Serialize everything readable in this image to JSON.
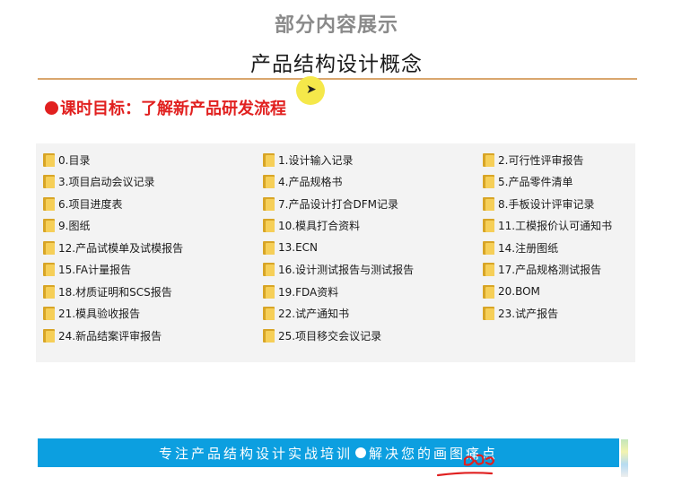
{
  "header": {
    "top_title": "部分内容展示",
    "slide_title": "产品结构设计概念"
  },
  "objective": {
    "text": "课时目标：了解新产品研发流程",
    "color": "#e1201f"
  },
  "files": [
    {
      "label": "0.目录",
      "icon": "folder-icon"
    },
    {
      "label": "1.设计输入记录",
      "icon": "folder-icon"
    },
    {
      "label": "2.可行性评审报告",
      "icon": "folder-icon"
    },
    {
      "label": "3.项目启动会议记录",
      "icon": "folder-icon"
    },
    {
      "label": "4.产品规格书",
      "icon": "folder-icon"
    },
    {
      "label": "5.产品零件清单",
      "icon": "folder-icon"
    },
    {
      "label": "6.项目进度表",
      "icon": "folder-icon"
    },
    {
      "label": "7.产品设计打合DFM记录",
      "icon": "folder-icon"
    },
    {
      "label": "8.手板设计评审记录",
      "icon": "folder-icon"
    },
    {
      "label": "9.图纸",
      "icon": "folder-icon"
    },
    {
      "label": "10.模具打合资料",
      "icon": "folder-icon"
    },
    {
      "label": "11.工模报价认可通知书",
      "icon": "folder-icon"
    },
    {
      "label": "12.产品试模单及试模报告",
      "icon": "folder-icon"
    },
    {
      "label": "13.ECN",
      "icon": "folder-icon"
    },
    {
      "label": "14.注册图纸",
      "icon": "folder-icon"
    },
    {
      "label": "15.FA计量报告",
      "icon": "folder-icon"
    },
    {
      "label": "16.设计测试报告与测试报告",
      "icon": "folder-icon"
    },
    {
      "label": "17.产品规格测试报告",
      "icon": "folder-icon"
    },
    {
      "label": "18.材质证明和SCS报告",
      "icon": "folder-icon"
    },
    {
      "label": "19.FDA资料",
      "icon": "folder-icon"
    },
    {
      "label": "20.BOM",
      "icon": "folder-icon"
    },
    {
      "label": "21.模具验收报告",
      "icon": "folder-icon"
    },
    {
      "label": "22.试产通知书",
      "icon": "folder-icon"
    },
    {
      "label": "23.试产报告",
      "icon": "folder-icon"
    },
    {
      "label": "24.新品结案评审报告",
      "icon": "folder-icon"
    },
    {
      "label": "25.项目移交会议记录",
      "icon": "folder-icon"
    }
  ],
  "banner": {
    "text_left": "专注产品结构设计实战培训",
    "text_right": "解决您的画图痛点",
    "color": "#0c9fe0"
  },
  "colors": {
    "rule": "#d9a66e",
    "cursor_highlight": "#f5e84a",
    "folder": "#f6cf58"
  }
}
